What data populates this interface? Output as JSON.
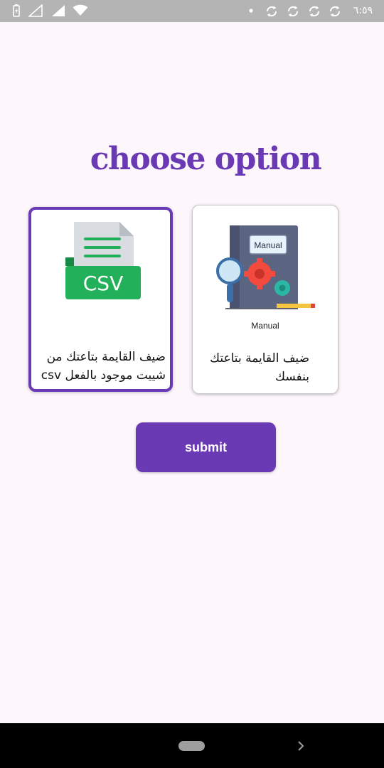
{
  "status_bar": {
    "time": "٦:٥٩",
    "left_icons": [
      "battery-charging-icon",
      "signal-empty-icon",
      "signal-icon",
      "wifi-icon"
    ],
    "right_icons": [
      "dot-icon",
      "sync-icon",
      "sync-icon",
      "sync-icon",
      "sync-icon"
    ]
  },
  "header": {
    "title": "choose option"
  },
  "options": [
    {
      "id": "csv",
      "icon_text": "CSV",
      "label": "ضيف القايمة بتاعتك من شييت موجود بالفعل csv",
      "selected": true
    },
    {
      "id": "manual",
      "badge_text": "Manual",
      "caption": "Manual",
      "label": "ضيف القايمة بتاعتك بنفسك",
      "selected": false
    }
  ],
  "submit": {
    "label": "submit"
  },
  "colors": {
    "accent": "#6a3ab4",
    "background": "#fdf7fc",
    "status_bar": "#b4b4b4",
    "csv_green": "#22b05a"
  },
  "nav_bar": {
    "icons": [
      "home-pill-icon",
      "chevron-right-icon"
    ]
  }
}
